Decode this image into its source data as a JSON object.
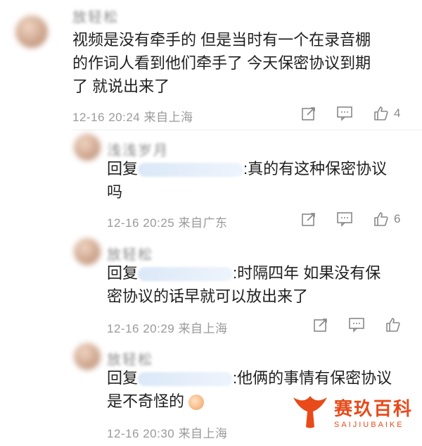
{
  "comments": [
    {
      "username": "放轻松",
      "text": "视频是没有牵手的 但是当时有一个在录音棚的作词人看到他们牵手了 今天保密协议到期了 就说出来了",
      "line1": "视频是没有牵手的 但是当时有一个在录音棚",
      "line2": "的作词人看到他们牵手了 今天保密协议到期",
      "line3": "了 就说出来了",
      "time": "12-16 20:24",
      "location": "来自上海",
      "likes": "4"
    }
  ],
  "replies": [
    {
      "username": "浅浅岁月",
      "reply_prefix": "回复",
      "mention": "@放轻松",
      "line1_suffix": ":真的有这种保密协议",
      "line2": "吗",
      "time": "12-16 20:25",
      "location": "来自广东",
      "likes": "6"
    },
    {
      "username": "放轻松",
      "reply_prefix": "回复",
      "mention": "@浅浅岁月",
      "line1_suffix": ":时隔四年 如果没有保",
      "line2": "密协议的话早就可以放出来了",
      "time": "12-16 20:29",
      "location": "来自上海",
      "likes": ""
    },
    {
      "username": "放轻松",
      "reply_prefix": "回复",
      "mention": "@浅浅岁月",
      "line1_suffix": ":他俩的事情有保密协议",
      "line2": "是不奇怪的",
      "time": "12-16 20:30",
      "location": "来自上海",
      "likes": ""
    }
  ],
  "watermark": {
    "cn": "赛玖百科",
    "en": "SAIJIUBAIKE"
  },
  "colors": {
    "meta": "#9a9a9a",
    "mention": "#5b8fd4",
    "brand": "#e84a1a"
  }
}
